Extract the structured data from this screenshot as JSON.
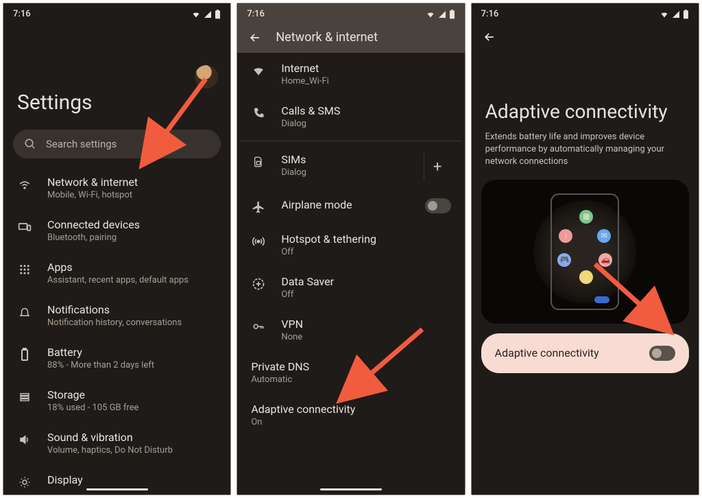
{
  "status_time": "7:16",
  "screen1": {
    "title": "Settings",
    "search_placeholder": "Search settings",
    "items": [
      {
        "title": "Network & internet",
        "sub": "Mobile, Wi-Fi, hotspot"
      },
      {
        "title": "Connected devices",
        "sub": "Bluetooth, pairing"
      },
      {
        "title": "Apps",
        "sub": "Assistant, recent apps, default apps"
      },
      {
        "title": "Notifications",
        "sub": "Notification history, conversations"
      },
      {
        "title": "Battery",
        "sub": "88% - More than 2 days left"
      },
      {
        "title": "Storage",
        "sub": "18% used - 105 GB free"
      },
      {
        "title": "Sound & vibration",
        "sub": "Volume, haptics, Do Not Disturb"
      },
      {
        "title": "Display",
        "sub": ""
      }
    ]
  },
  "screen2": {
    "title": "Network & internet",
    "items": [
      {
        "title": "Internet",
        "sub": "Home_Wi-Fi"
      },
      {
        "title": "Calls & SMS",
        "sub": "Dialog"
      },
      {
        "title": "SIMs",
        "sub": "Dialog"
      },
      {
        "title": "Airplane mode",
        "sub": ""
      },
      {
        "title": "Hotspot & tethering",
        "sub": "Off"
      },
      {
        "title": "Data Saver",
        "sub": "Off"
      },
      {
        "title": "VPN",
        "sub": "None"
      },
      {
        "title": "Private DNS",
        "sub": "Automatic"
      },
      {
        "title": "Adaptive connectivity",
        "sub": "On"
      }
    ]
  },
  "screen3": {
    "title": "Adaptive connectivity",
    "desc": "Extends battery life and improves device performance by automatically managing your network connections",
    "toggle_label": "Adaptive connectivity",
    "toggle_state": "off"
  }
}
